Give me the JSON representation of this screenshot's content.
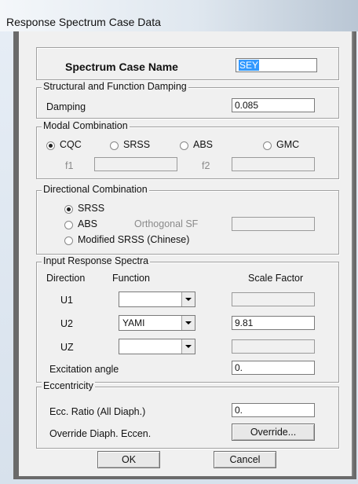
{
  "window": {
    "title": "Response Spectrum Case Data"
  },
  "case": {
    "name_label": "Spectrum Case Name",
    "name_value": "SEY"
  },
  "damping": {
    "group_label": "Structural and Function Damping",
    "label": "Damping",
    "value": "0.085"
  },
  "modal": {
    "group_label": "Modal Combination",
    "options": [
      "CQC",
      "SRSS",
      "ABS",
      "GMC"
    ],
    "selected": "CQC",
    "f1_label": "f1",
    "f1_value": "",
    "f2_label": "f2",
    "f2_value": ""
  },
  "directional": {
    "group_label": "Directional Combination",
    "options": [
      "SRSS",
      "ABS",
      "Modified SRSS (Chinese)"
    ],
    "selected": "SRSS",
    "orthogonal_label": "Orthogonal SF",
    "orthogonal_value": ""
  },
  "input_spectra": {
    "group_label": "Input Response Spectra",
    "col_direction": "Direction",
    "col_function": "Function",
    "col_scale": "Scale Factor",
    "rows": [
      {
        "direction": "U1",
        "function": "",
        "scale": ""
      },
      {
        "direction": "U2",
        "function": "YAMI",
        "scale": "9.81"
      },
      {
        "direction": "UZ",
        "function": "",
        "scale": ""
      }
    ],
    "excitation_label": "Excitation angle",
    "excitation_value": "0."
  },
  "eccentricity": {
    "group_label": "Eccentricity",
    "ratio_label": "Ecc. Ratio (All Diaph.)",
    "ratio_value": "0.",
    "override_label": "Override Diaph. Eccen.",
    "override_button": "Override..."
  },
  "buttons": {
    "ok": "OK",
    "cancel": "Cancel"
  }
}
